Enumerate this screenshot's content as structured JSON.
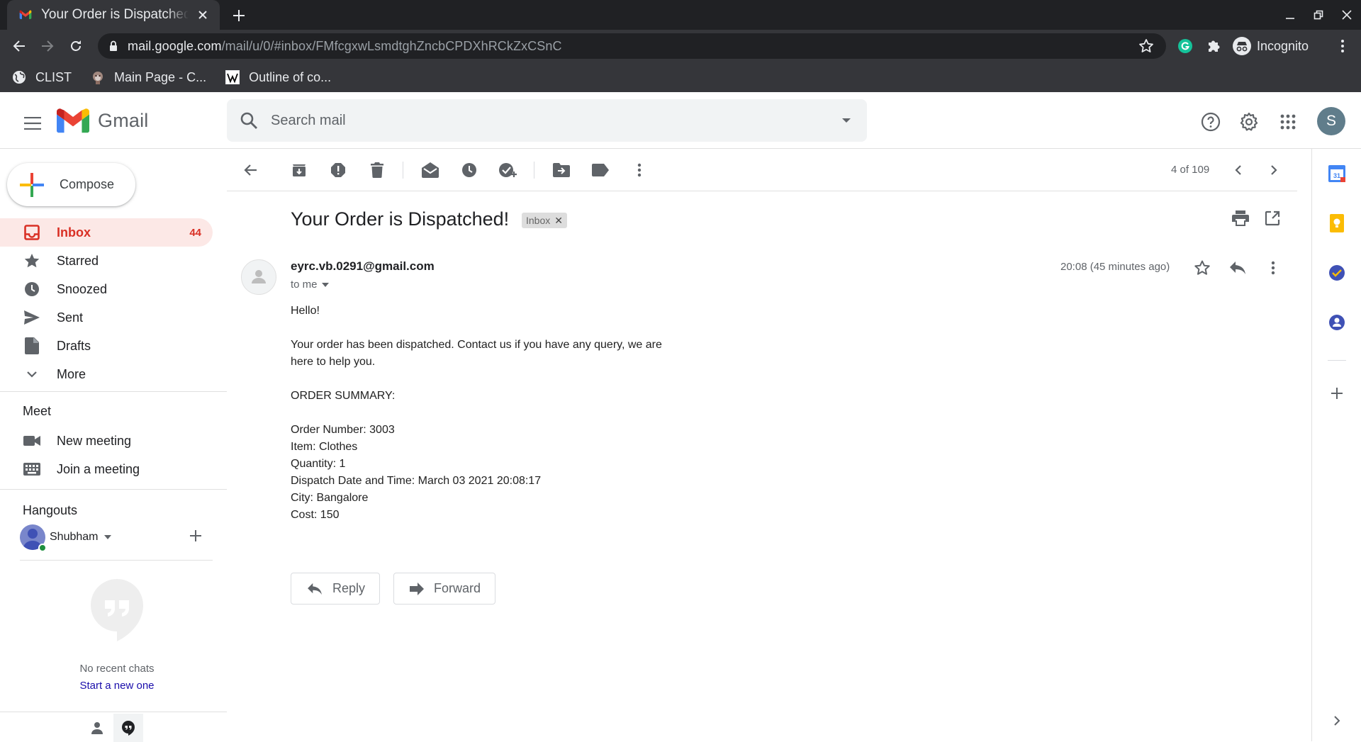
{
  "browser": {
    "tab_title": "Your Order is Dispatched!",
    "url_host": "mail.google.com",
    "url_path": "/mail/u/0/#inbox/FMfcgxwLsmdtghZncbCPDXhRCkZxCSnC",
    "incognito_label": "Incognito",
    "bookmarks": [
      {
        "label": "CLIST",
        "icon": "globe-icon"
      },
      {
        "label": "Main Page - C...",
        "icon": "monkey-icon"
      },
      {
        "label": "Outline of co...",
        "icon": "wikipedia-icon"
      }
    ]
  },
  "gmail": {
    "logo_text": "Gmail",
    "search_placeholder": "Search mail",
    "account_initial": "S"
  },
  "sidebar": {
    "compose_label": "Compose",
    "items": [
      {
        "label": "Inbox",
        "count": "44",
        "icon": "inbox-icon",
        "active": true
      },
      {
        "label": "Starred",
        "icon": "star-icon"
      },
      {
        "label": "Snoozed",
        "icon": "clock-icon"
      },
      {
        "label": "Sent",
        "icon": "send-icon"
      },
      {
        "label": "Drafts",
        "icon": "draft-icon"
      },
      {
        "label": "More",
        "icon": "chevron-down-icon"
      }
    ],
    "meet": {
      "title": "Meet",
      "new_meeting": "New meeting",
      "join_meeting": "Join a meeting"
    },
    "hangouts": {
      "title": "Hangouts",
      "user": "Shubham",
      "no_chats": "No recent chats",
      "start_new": "Start a new one"
    }
  },
  "message": {
    "pager": "4 of 109",
    "subject": "Your Order is Dispatched!",
    "label": "Inbox",
    "sender": "eyrc.vb.0291@gmail.com",
    "to": "to me",
    "time": "20:08 (45 minutes ago)",
    "body": {
      "greeting": "Hello!",
      "intro_1": "Your order has been dispatched. Contact us if you have any query, we are",
      "intro_2": "here to help you.",
      "summary_title": "ORDER SUMMARY:",
      "order_number": "Order Number: 3003",
      "item": "Item: Clothes",
      "quantity": "Quantity: 1",
      "dispatch": "Dispatch Date and Time: March 03 2021 20:08:17",
      "city": "City: Bangalore",
      "cost": "Cost: 150"
    },
    "reply_label": "Reply",
    "forward_label": "Forward"
  },
  "colors": {
    "gmail_red": "#d93025",
    "active_bg": "#fce8e6",
    "chrome_dark": "#202124",
    "chrome_toolbar": "#35363a"
  }
}
